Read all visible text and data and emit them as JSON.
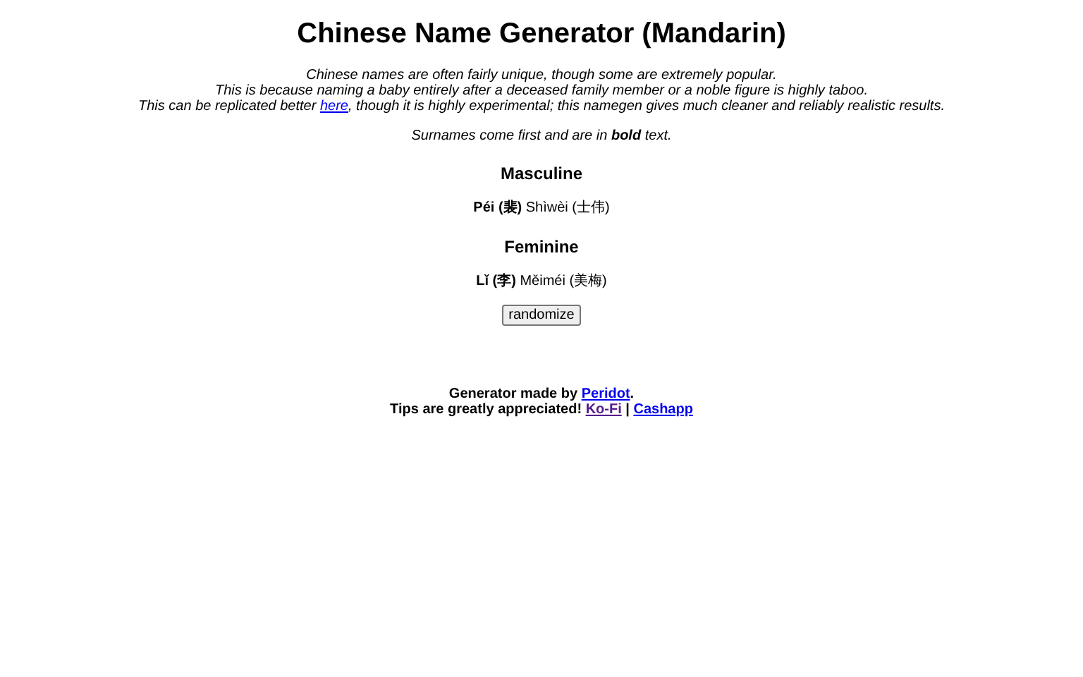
{
  "title": "Chinese Name Generator (Mandarin)",
  "intro": [
    {
      "text": "Chinese names are often fairly unique, though some are extremely popular."
    },
    {
      "text": "This is because naming a baby entirely after a deceased family member or a noble figure is highly taboo."
    },
    {
      "before": "This can be replicated better ",
      "link": {
        "label": "here",
        "visited": false
      },
      "after": ", though it is highly experimental; this namegen gives much cleaner and reliably realistic results."
    }
  ],
  "note": "Surnames come first and are in **bold** text.",
  "sections": [
    {
      "heading": "Masculine",
      "name": {
        "surname": "Péi (裴)",
        "given": "Shìwèi (士伟)"
      }
    },
    {
      "heading": "Feminine",
      "name": {
        "surname": "Lǐ (李)",
        "given": "Měiméi (美梅)"
      }
    }
  ],
  "button": "randomize",
  "footer": {
    "credit": {
      "before": "Generator made by ",
      "link": {
        "label": "Peridot",
        "visited": false
      },
      "after": "."
    },
    "tips": {
      "before": "Tips are greatly appreciated! ",
      "links": [
        {
          "label": "Ko-Fi",
          "visited": true
        },
        {
          "label": "Cashapp",
          "visited": false
        }
      ],
      "separator": " | "
    }
  }
}
